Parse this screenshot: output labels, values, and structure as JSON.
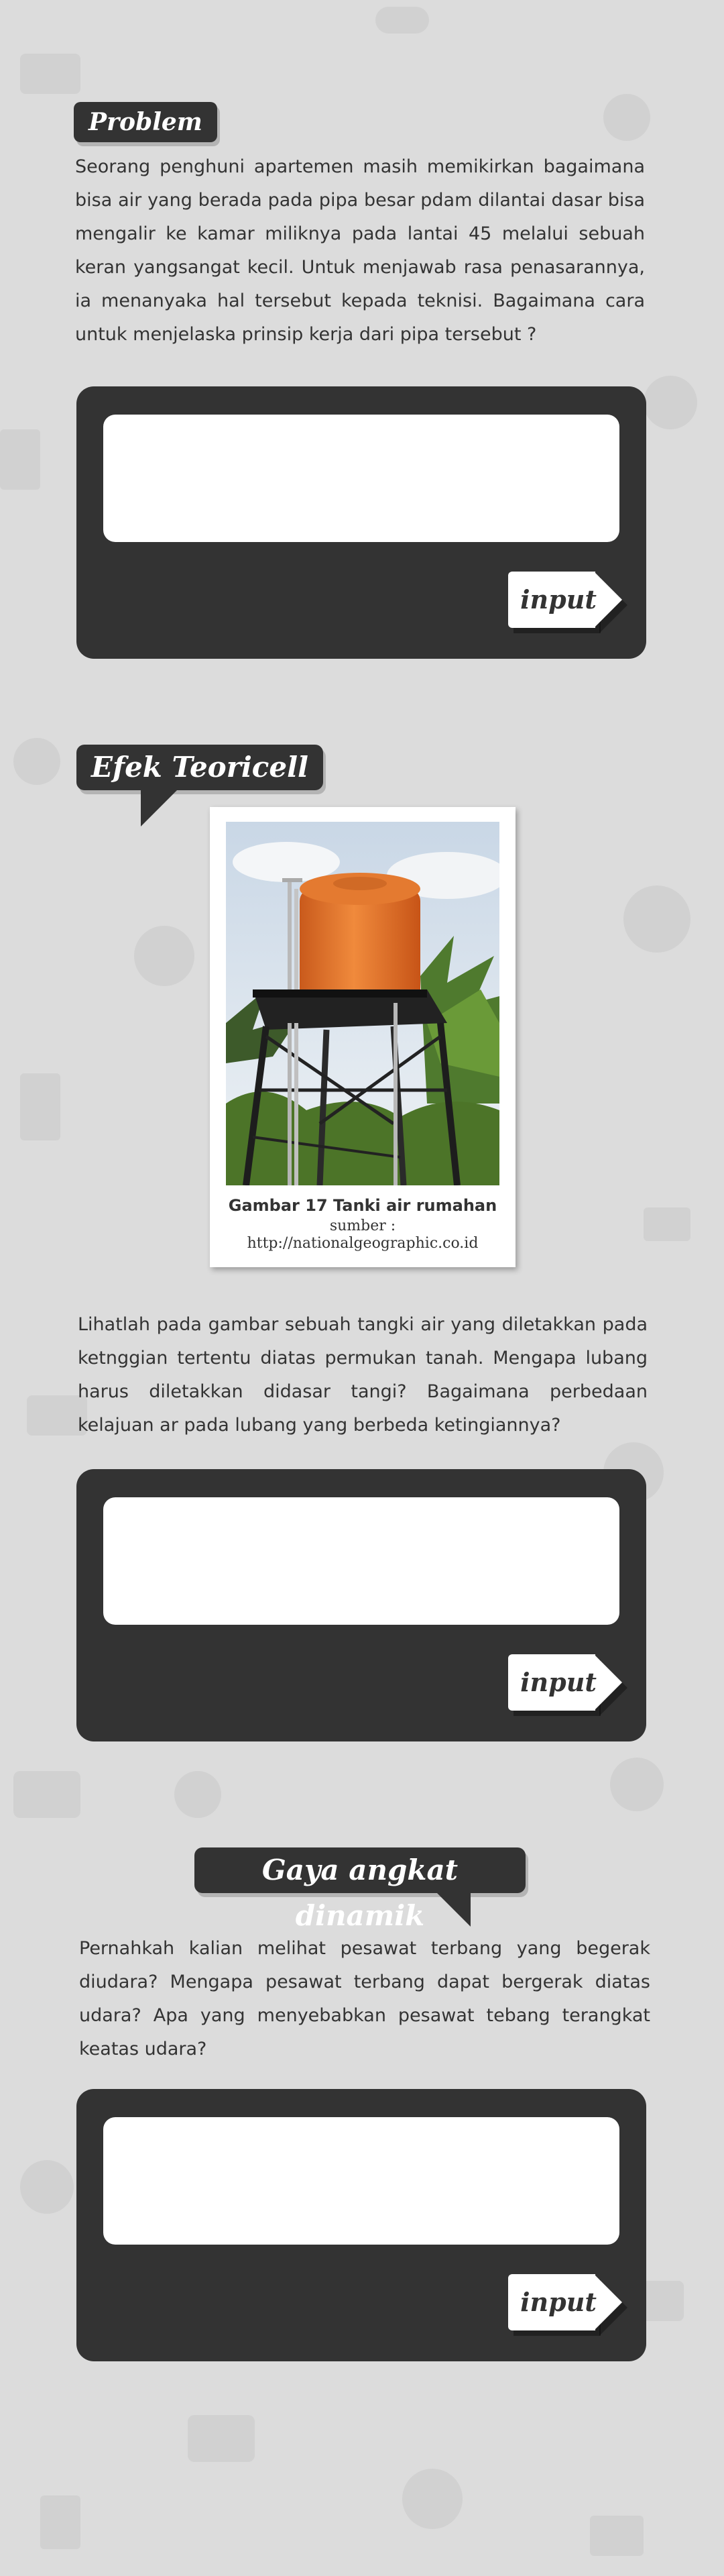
{
  "sections": [
    {
      "tag": "Problem",
      "text": "Seorang penghuni apartemen masih memikirkan bagaimana bisa air yang berada pada pipa besar pdam dilantai dasar bisa mengalir ke kamar miliknya pada lantai 45 melalui sebuah keran yangsangat kecil. Untuk menjawab rasa penasarannya, ia menanyaka hal tersebut kepada teknisi. Bagaimana cara untuk menjelaska prinsip kerja dari pipa tersebut ?",
      "button": "input"
    },
    {
      "tag": "Efek Teoricell",
      "figure_caption": "Gambar 17 Tanki air rumahan",
      "figure_source_label": "sumber :",
      "figure_source_url": "http://nationalgeographic.co.id",
      "text": "Lihatlah pada gambar sebuah tangki air yang diletakkan pada ketnggian tertentu diatas permukan tanah. Mengapa lubang harus diletakkan didasar tangi? Bagaimana perbedaan kelajuan ar pada lubang yang berbeda ketingiannya?",
      "button": "input"
    },
    {
      "tag": "Gaya angkat dinamik",
      "text": "Pernahkah kalian melihat pesawat terbang yang begerak diudara? Mengapa pesawat terbang dapat bergerak diatas udara? Apa yang menyebabkan pesawat tebang terangkat keatas udara?",
      "button": "input"
    }
  ],
  "colors": {
    "background": "#dcdcdc",
    "panel": "#333333",
    "text": "#333333",
    "tank": "#e8732a"
  }
}
